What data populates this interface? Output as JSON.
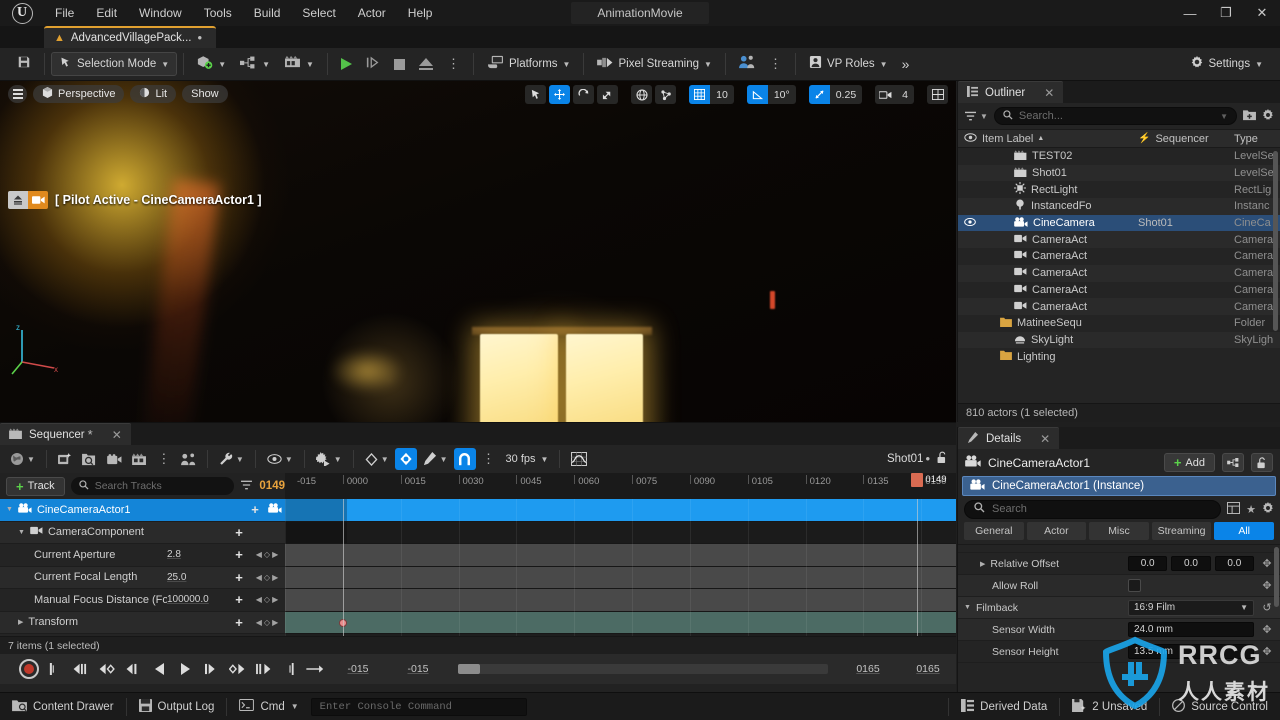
{
  "window": {
    "project_title": "AnimationMovie",
    "minimize": "—",
    "maximize": "❐",
    "close": "✕",
    "logo_glyph": "U"
  },
  "menubar": {
    "items": [
      "File",
      "Edit",
      "Window",
      "Tools",
      "Build",
      "Select",
      "Actor",
      "Help"
    ]
  },
  "level_tab": {
    "label": "AdvancedVillagePack...",
    "dirty": "•",
    "icon": "level-icon"
  },
  "toolbar": {
    "save_icon": "save-icon",
    "mode": "Selection Mode",
    "create_icon": "add-actor-icon",
    "blueprint_icon": "blueprints-icon",
    "cinematics_icon": "cinematics-icon",
    "play_label": "Play",
    "platforms": "Platforms",
    "pixel_streaming": "Pixel Streaming",
    "vp_roles": "VP Roles",
    "settings": "Settings",
    "overflow": "»"
  },
  "viewport": {
    "view_mode": "Perspective",
    "lighting": "Lit",
    "show": "Show",
    "pilot_text": "[ Pilot Active - CineCameraActor1 ]",
    "tools": {
      "select_icon": "select-arrow-icon",
      "move_icon": "move-gizmo-icon",
      "rotate_icon": "rotate-gizmo-icon",
      "scale_icon": "scale-gizmo-icon",
      "world_icon": "world-space-icon",
      "surface_snap_icon": "surface-snap-icon",
      "grid_snap_value": "10",
      "angle_snap_value": "10°",
      "scale_snap_value": "0.25",
      "camera_speed_value": "4",
      "layout_icon": "viewport-layout-icon"
    }
  },
  "outliner": {
    "title": "Outliner",
    "search_placeholder": "Search...",
    "columns": {
      "item_label": "Item Label",
      "sequencer": "Sequencer",
      "type": "Type",
      "sort_arrow": "▲"
    },
    "rows": [
      {
        "name": "Lighting",
        "icon": "folder-icon",
        "indent": 1,
        "sequencer": "",
        "type": "",
        "selected": false
      },
      {
        "name": "SkyLight",
        "icon": "skylight-icon",
        "indent": 2,
        "sequencer": "",
        "type": "SkyLigh",
        "selected": false
      },
      {
        "name": "MatineeSequ",
        "icon": "folder-icon",
        "indent": 1,
        "sequencer": "",
        "type": "Folder",
        "selected": false
      },
      {
        "name": "CameraAct",
        "icon": "camera-icon",
        "indent": 2,
        "sequencer": "",
        "type": "Camera",
        "selected": false
      },
      {
        "name": "CameraAct",
        "icon": "camera-icon",
        "indent": 2,
        "sequencer": "",
        "type": "Camera",
        "selected": false
      },
      {
        "name": "CameraAct",
        "icon": "camera-icon",
        "indent": 2,
        "sequencer": "",
        "type": "Camera",
        "selected": false
      },
      {
        "name": "CameraAct",
        "icon": "camera-icon",
        "indent": 2,
        "sequencer": "",
        "type": "Camera",
        "selected": false
      },
      {
        "name": "CameraAct",
        "icon": "camera-icon",
        "indent": 2,
        "sequencer": "",
        "type": "Camera",
        "selected": false
      },
      {
        "name": "CineCamera",
        "icon": "cinecamera-icon",
        "indent": 2,
        "sequencer": "Shot01",
        "type": "CineCa",
        "selected": true
      },
      {
        "name": "InstancedFo",
        "icon": "foliage-icon",
        "indent": 2,
        "sequencer": "",
        "type": "Instanc",
        "selected": false
      },
      {
        "name": "RectLight",
        "icon": "rectlight-icon",
        "indent": 2,
        "sequencer": "",
        "type": "RectLig",
        "selected": false
      },
      {
        "name": "Shot01",
        "icon": "levelsequence-icon",
        "indent": 2,
        "sequencer": "",
        "type": "LevelSe",
        "selected": false
      },
      {
        "name": "TEST02",
        "icon": "levelsequence-icon",
        "indent": 2,
        "sequencer": "",
        "type": "LevelSe",
        "selected": false
      }
    ],
    "status": "810 actors (1 selected)"
  },
  "details": {
    "title": "Details",
    "actor_name": "CineCameraActor1",
    "add_label": "Add",
    "instance_row": "CineCameraActor1 (Instance)",
    "search_placeholder": "Search",
    "filter_tabs": [
      "General",
      "Actor",
      "Misc",
      "Streaming",
      "All"
    ],
    "active_filter_tab": "All",
    "properties": [
      {
        "label": "Relative Offset",
        "kind": "vector3",
        "values": [
          "0.0",
          "0.0",
          "0.0"
        ],
        "expandable": true
      },
      {
        "label": "Allow Roll",
        "kind": "checkbox",
        "values": [],
        "expandable": false
      },
      {
        "label": "Filmback",
        "kind": "combo",
        "values": [
          "16:9 Film"
        ],
        "expandable": true,
        "category": true
      },
      {
        "label": "Sensor Width",
        "kind": "text",
        "values": [
          "24.0 mm"
        ],
        "expandable": false
      },
      {
        "label": "Sensor Height",
        "kind": "text",
        "values": [
          "13.5 mm"
        ],
        "expandable": false
      }
    ]
  },
  "sequencer": {
    "title": "Sequencer",
    "dirty": "*",
    "fps": "30 fps",
    "shot_label": "Shot01",
    "shot_dirty": "•",
    "add_track_label": "Track",
    "search_placeholder": "Search Tracks",
    "current_frame": "0149",
    "playhead_label": "0149",
    "ruler_ticks": [
      "-015",
      "0000",
      "0015",
      "0030",
      "0045",
      "0060",
      "0075",
      "0090",
      "0105",
      "0120",
      "0135",
      "0150"
    ],
    "tracks": [
      {
        "label": "CineCameraActor1",
        "icon": "cinecamera-icon",
        "indent": 0,
        "value": "",
        "selected": true,
        "lane": "blue"
      },
      {
        "label": "CameraComponent",
        "icon": "camera-icon",
        "indent": 1,
        "value": "",
        "selected": false,
        "lane": "dark"
      },
      {
        "label": "Current Aperture",
        "icon": "",
        "indent": 2,
        "value": "2.8",
        "selected": false,
        "lane": "mid"
      },
      {
        "label": "Current Focal Length",
        "icon": "",
        "indent": 2,
        "value": "25.0",
        "selected": false,
        "lane": "mid"
      },
      {
        "label": "Manual Focus Distance (Fo",
        "icon": "",
        "indent": 2,
        "value": "100000.0",
        "selected": false,
        "lane": "mid"
      },
      {
        "label": "Transform",
        "icon": "",
        "indent": 1,
        "value": "",
        "selected": false,
        "lane": "green"
      }
    ],
    "status": "7 items (1 selected)",
    "playback": {
      "start_frame": "-015",
      "current_start": "-015",
      "end_frame": "0165",
      "range_end": "0165"
    }
  },
  "statusbar": {
    "content_drawer": "Content Drawer",
    "output_log": "Output Log",
    "cmd": "Cmd",
    "console_placeholder": "Enter Console Command",
    "derived_data": "Derived Data",
    "unsaved": "2 Unsaved",
    "source_control": "Source Control"
  },
  "watermark": {
    "text": "RRCG",
    "cn": "人人素材"
  },
  "colors": {
    "accent_blue": "#0a84e8",
    "selection_blue": "#2b4e78",
    "track_blue": "#1e9bf0",
    "amber": "#e8a33d",
    "green": "#5bd24a"
  }
}
